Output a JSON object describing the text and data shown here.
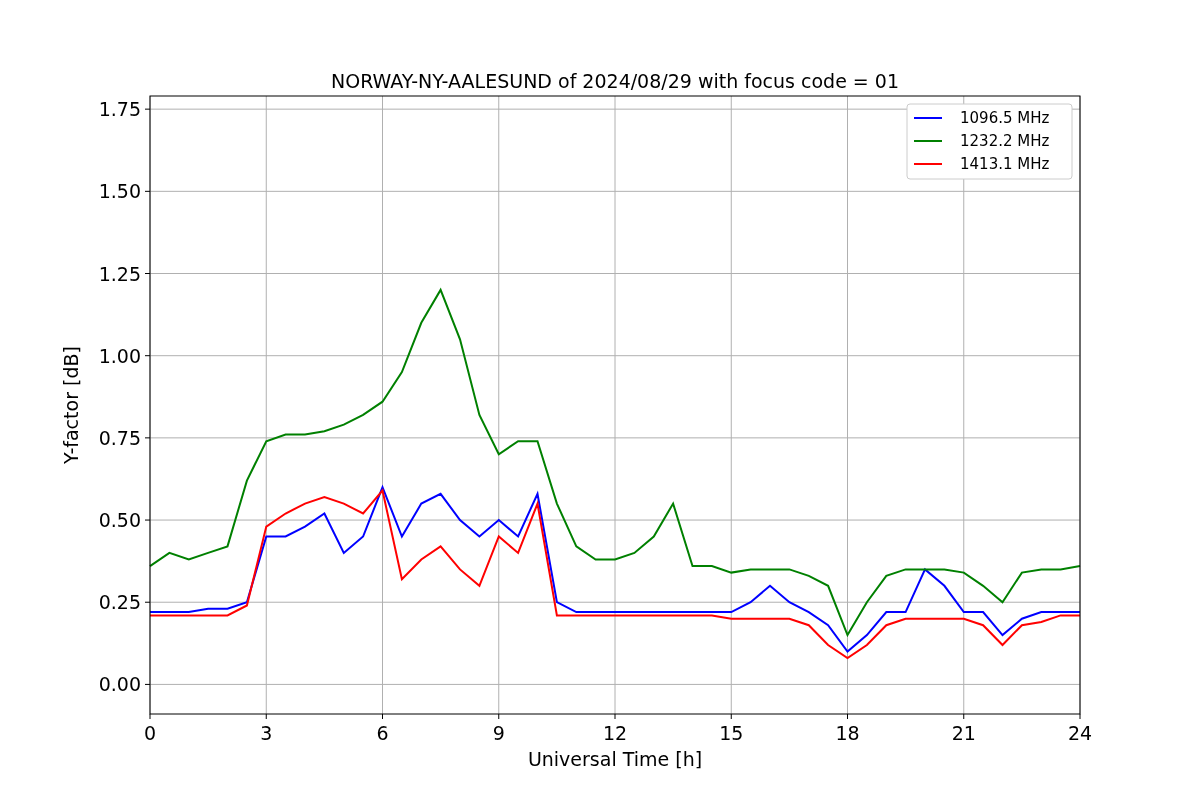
{
  "figure": {
    "chart_data": {
      "type": "line",
      "title": "NORWAY-NY-AALESUND of 2024/08/29 with focus code = 01",
      "xlabel": "Universal Time [h]",
      "ylabel": "Y-factor [dB]",
      "x": [
        0,
        0.5,
        1,
        1.5,
        2,
        2.5,
        3,
        3.5,
        4,
        4.5,
        5,
        5.5,
        6,
        6.5,
        7,
        7.5,
        8,
        8.5,
        9,
        9.5,
        10,
        10.5,
        11,
        11.5,
        12,
        12.5,
        13,
        13.5,
        14,
        14.5,
        15,
        15.5,
        16,
        16.5,
        17,
        17.5,
        18,
        18.5,
        19,
        19.5,
        20,
        20.5,
        21,
        21.5,
        22,
        22.5,
        23,
        23.5,
        24
      ],
      "series": [
        {
          "name": "1096.5 MHz",
          "color": "#0000ff",
          "values": [
            0.22,
            0.22,
            0.22,
            0.23,
            0.23,
            0.25,
            0.45,
            0.45,
            0.48,
            0.52,
            0.4,
            0.45,
            0.6,
            0.45,
            0.55,
            0.58,
            0.5,
            0.45,
            0.5,
            0.45,
            0.58,
            0.25,
            0.22,
            0.22,
            0.22,
            0.22,
            0.22,
            0.22,
            0.22,
            0.22,
            0.22,
            0.25,
            0.3,
            0.25,
            0.22,
            0.18,
            0.1,
            0.15,
            0.22,
            0.22,
            0.35,
            0.3,
            0.22,
            0.22,
            0.15,
            0.2,
            0.22,
            0.22,
            0.22
          ]
        },
        {
          "name": "1232.2 MHz",
          "color": "#008000",
          "values": [
            0.36,
            0.4,
            0.38,
            0.4,
            0.42,
            0.62,
            0.74,
            0.76,
            0.76,
            0.77,
            0.79,
            0.82,
            0.86,
            0.95,
            1.1,
            1.2,
            1.05,
            0.82,
            0.7,
            0.74,
            0.74,
            0.55,
            0.42,
            0.38,
            0.38,
            0.4,
            0.45,
            0.55,
            0.36,
            0.36,
            0.34,
            0.35,
            0.35,
            0.35,
            0.33,
            0.3,
            0.15,
            0.25,
            0.33,
            0.35,
            0.35,
            0.35,
            0.34,
            0.3,
            0.25,
            0.34,
            0.35,
            0.35,
            0.36
          ]
        },
        {
          "name": "1413.1 MHz",
          "color": "#ff0000",
          "values": [
            0.21,
            0.21,
            0.21,
            0.21,
            0.21,
            0.24,
            0.48,
            0.52,
            0.55,
            0.57,
            0.55,
            0.52,
            0.59,
            0.32,
            0.38,
            0.42,
            0.35,
            0.3,
            0.45,
            0.4,
            0.55,
            0.21,
            0.21,
            0.21,
            0.21,
            0.21,
            0.21,
            0.21,
            0.21,
            0.21,
            0.2,
            0.2,
            0.2,
            0.2,
            0.18,
            0.12,
            0.08,
            0.12,
            0.18,
            0.2,
            0.2,
            0.2,
            0.2,
            0.18,
            0.12,
            0.18,
            0.19,
            0.21,
            0.21
          ]
        }
      ],
      "grid": true,
      "legend": "upper right",
      "xlim": [
        0,
        24
      ],
      "ylim": [
        -0.09,
        1.79
      ],
      "xticks": [
        0,
        3,
        6,
        9,
        12,
        15,
        18,
        21,
        24
      ],
      "yticks": [
        {
          "value": 0,
          "label": "0.00"
        },
        {
          "value": 0.25,
          "label": "0.25"
        },
        {
          "value": 0.5,
          "label": "0.50"
        },
        {
          "value": 0.75,
          "label": "0.75"
        },
        {
          "value": 1,
          "label": "1.00"
        },
        {
          "value": 1.25,
          "label": "1.25"
        },
        {
          "value": 1.5,
          "label": "1.50"
        },
        {
          "value": 1.75,
          "label": "1.75"
        }
      ]
    }
  }
}
